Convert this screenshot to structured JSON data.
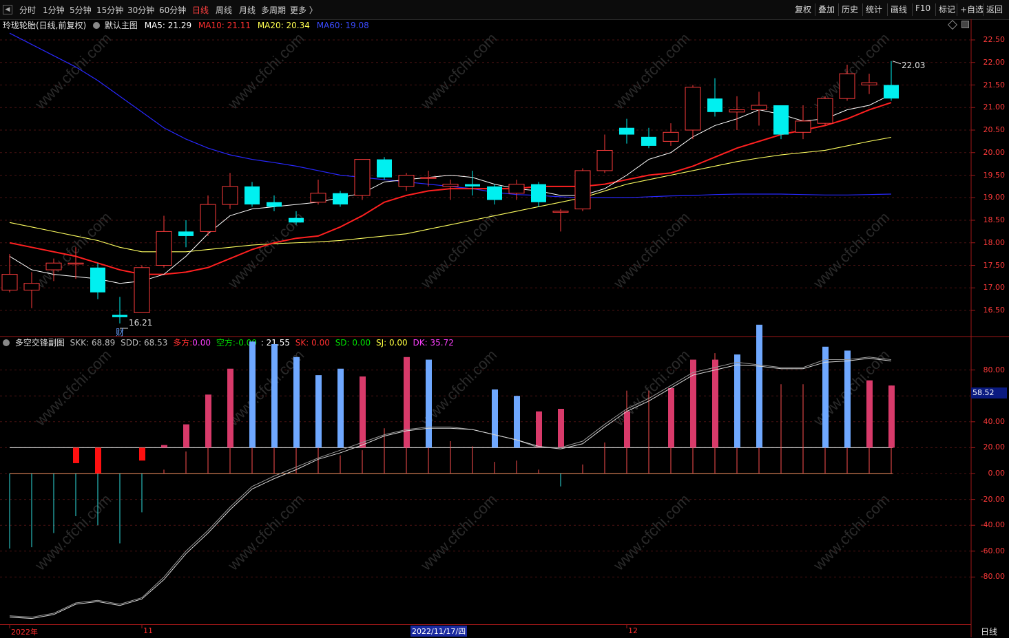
{
  "toolbar": {
    "left_items": [
      "分时",
      "1分钟",
      "5分钟",
      "15分钟",
      "30分钟",
      "60分钟",
      "日线",
      "周线",
      "月线",
      "多周期",
      "更多 〉"
    ],
    "active_item": "日线",
    "right_items": [
      "复权",
      "叠加",
      "历史",
      "统计",
      "画线",
      "F10",
      "标记",
      "+自选",
      "返回"
    ]
  },
  "main_header": {
    "stock_name": "玲珑轮胎(日线,前复权)",
    "template": "默认主图",
    "ma5": "MA5: 21.29",
    "ma10": "MA10: 21.11",
    "ma20": "MA20: 20.34",
    "ma60": "MA60: 19.08"
  },
  "sub_header": {
    "title": "多空交锋副图",
    "skk": "SKK: 68.89",
    "sdd": "SDD: 68.53",
    "duofang_label": "多方:",
    "duofang_value": "0.00",
    "kongfang_label": "空方:",
    "kongfang_value": "-0.00",
    "extra": ": 21.55",
    "sk": "SK: 0.00",
    "sd": "SD: 0.00",
    "sj": "SJ: 0.00",
    "dk": "DK: 35.72"
  },
  "price_axis": [
    "22.50",
    "22.00",
    "21.50",
    "21.00",
    "20.50",
    "20.00",
    "19.50",
    "19.00",
    "18.50",
    "18.00",
    "17.50",
    "17.00",
    "16.50"
  ],
  "sub_axis": [
    "80.00",
    "60.00",
    "40.00",
    "20.00",
    "0.00",
    "-20.00",
    "-40.00",
    "-60.00",
    "-80.00"
  ],
  "sub_marker": "58.52",
  "annotations": {
    "high": "22.03",
    "low": "16.21",
    "cai": "财"
  },
  "date_axis": {
    "start": "2022年",
    "m11": "11",
    "cursor": "2022/11/17/四",
    "m12": "12",
    "period": "日线"
  },
  "watermark": "www.cfchi.com",
  "colors": {
    "up": "#ff3c3c",
    "down": "#00f0f0",
    "ma5": "#ffffff",
    "ma10": "#ff2020",
    "ma20": "#ffff60",
    "ma60": "#2828ff"
  },
  "chart_data": {
    "type": "candlestick",
    "candles": [
      {
        "o": 16.95,
        "c": 17.3,
        "h": 17.75,
        "l": 16.9
      },
      {
        "o": 16.95,
        "c": 17.1,
        "h": 17.35,
        "l": 16.55
      },
      {
        "o": 17.4,
        "c": 17.55,
        "h": 17.65,
        "l": 17.15
      },
      {
        "o": 17.55,
        "c": 17.55,
        "h": 17.9,
        "l": 17.2
      },
      {
        "o": 17.45,
        "c": 16.9,
        "h": 17.55,
        "l": 16.75
      },
      {
        "o": 16.4,
        "c": 16.35,
        "h": 16.8,
        "l": 16.21
      },
      {
        "o": 16.45,
        "c": 17.45,
        "h": 17.5,
        "l": 16.45
      },
      {
        "o": 17.5,
        "c": 18.25,
        "h": 18.6,
        "l": 17.45
      },
      {
        "o": 18.25,
        "c": 18.15,
        "h": 18.5,
        "l": 17.9
      },
      {
        "o": 18.25,
        "c": 18.85,
        "h": 19.05,
        "l": 18.15
      },
      {
        "o": 18.85,
        "c": 19.25,
        "h": 19.55,
        "l": 18.75
      },
      {
        "o": 19.25,
        "c": 18.85,
        "h": 19.35,
        "l": 18.8
      },
      {
        "o": 18.9,
        "c": 18.8,
        "h": 19.05,
        "l": 18.7
      },
      {
        "o": 18.55,
        "c": 18.45,
        "h": 18.7,
        "l": 18.4
      },
      {
        "o": 18.9,
        "c": 19.1,
        "h": 19.4,
        "l": 18.85
      },
      {
        "o": 19.1,
        "c": 18.85,
        "h": 19.15,
        "l": 18.8
      },
      {
        "o": 19.05,
        "c": 19.85,
        "h": 19.85,
        "l": 18.95
      },
      {
        "o": 19.85,
        "c": 19.45,
        "h": 19.9,
        "l": 19.4
      },
      {
        "o": 19.25,
        "c": 19.5,
        "h": 19.55,
        "l": 19.15
      },
      {
        "o": 19.45,
        "c": 19.45,
        "h": 19.6,
        "l": 19.25
      },
      {
        "o": 19.25,
        "c": 19.3,
        "h": 19.4,
        "l": 18.95
      },
      {
        "o": 19.3,
        "c": 19.25,
        "h": 19.6,
        "l": 19.05
      },
      {
        "o": 19.25,
        "c": 18.95,
        "h": 19.3,
        "l": 18.85
      },
      {
        "o": 19.1,
        "c": 19.3,
        "h": 19.4,
        "l": 18.95
      },
      {
        "o": 19.3,
        "c": 18.9,
        "h": 19.35,
        "l": 18.8
      },
      {
        "o": 18.7,
        "c": 18.7,
        "h": 18.75,
        "l": 18.25
      },
      {
        "o": 18.75,
        "c": 19.6,
        "h": 19.65,
        "l": 18.7
      },
      {
        "o": 19.6,
        "c": 20.05,
        "h": 20.4,
        "l": 19.55
      },
      {
        "o": 20.55,
        "c": 20.4,
        "h": 20.75,
        "l": 20.2
      },
      {
        "o": 20.35,
        "c": 20.15,
        "h": 20.55,
        "l": 20.1
      },
      {
        "o": 20.25,
        "c": 20.45,
        "h": 20.65,
        "l": 20.15
      },
      {
        "o": 20.5,
        "c": 21.45,
        "h": 21.5,
        "l": 20.3
      },
      {
        "o": 21.2,
        "c": 20.9,
        "h": 21.65,
        "l": 20.8
      },
      {
        "o": 20.9,
        "c": 20.95,
        "h": 21.25,
        "l": 20.5
      },
      {
        "o": 20.95,
        "c": 21.05,
        "h": 21.35,
        "l": 20.6
      },
      {
        "o": 21.05,
        "c": 20.4,
        "h": 21.05,
        "l": 20.3
      },
      {
        "o": 20.45,
        "c": 20.7,
        "h": 21.05,
        "l": 20.3
      },
      {
        "o": 20.65,
        "c": 21.2,
        "h": 21.25,
        "l": 20.6
      },
      {
        "o": 21.2,
        "c": 21.75,
        "h": 21.95,
        "l": 21.15
      },
      {
        "o": 21.5,
        "c": 21.55,
        "h": 21.75,
        "l": 21.3
      },
      {
        "o": 21.5,
        "c": 21.2,
        "h": 22.03,
        "l": 21.15
      }
    ],
    "ma5": [
      17.7,
      17.4,
      17.3,
      17.25,
      17.2,
      17.1,
      17.15,
      17.3,
      17.7,
      18.2,
      18.6,
      18.75,
      18.8,
      18.85,
      18.9,
      19.0,
      19.1,
      19.35,
      19.4,
      19.45,
      19.5,
      19.45,
      19.3,
      19.2,
      19.15,
      19.05,
      19.05,
      19.2,
      19.5,
      19.85,
      20.0,
      20.35,
      20.6,
      20.75,
      20.95,
      20.85,
      20.7,
      20.75,
      20.95,
      21.05,
      21.29
    ],
    "ma10": [
      18.0,
      17.9,
      17.8,
      17.7,
      17.55,
      17.4,
      17.3,
      17.3,
      17.35,
      17.45,
      17.65,
      17.85,
      18.0,
      18.1,
      18.15,
      18.35,
      18.6,
      18.9,
      19.05,
      19.15,
      19.2,
      19.2,
      19.2,
      19.2,
      19.25,
      19.25,
      19.25,
      19.3,
      19.4,
      19.5,
      19.55,
      19.7,
      19.9,
      20.1,
      20.25,
      20.4,
      20.5,
      20.6,
      20.75,
      20.95,
      21.11
    ],
    "ma20": [
      18.45,
      18.35,
      18.25,
      18.15,
      18.05,
      17.9,
      17.8,
      17.8,
      17.8,
      17.85,
      17.9,
      17.95,
      17.98,
      18.0,
      18.02,
      18.05,
      18.1,
      18.15,
      18.2,
      18.3,
      18.4,
      18.5,
      18.6,
      18.7,
      18.8,
      18.9,
      19.0,
      19.15,
      19.3,
      19.4,
      19.5,
      19.6,
      19.7,
      19.8,
      19.88,
      19.95,
      20.0,
      20.05,
      20.15,
      20.25,
      20.34
    ],
    "ma60": [
      22.65,
      22.4,
      22.15,
      21.9,
      21.6,
      21.25,
      20.9,
      20.55,
      20.3,
      20.1,
      19.95,
      19.85,
      19.78,
      19.7,
      19.6,
      19.5,
      19.45,
      19.4,
      19.35,
      19.3,
      19.25,
      19.2,
      19.12,
      19.07,
      19.05,
      19.02,
      19.0,
      19.0,
      19.0,
      19.02,
      19.04,
      19.05,
      19.07,
      19.08,
      19.08,
      19.08,
      19.07,
      19.06,
      19.06,
      19.07,
      19.08
    ],
    "sub_bars": [
      -58,
      -57,
      -46,
      -33,
      -40,
      -54,
      -30,
      3,
      17,
      26,
      37,
      34,
      25,
      20,
      30,
      14,
      18,
      35,
      49,
      45,
      25,
      21,
      9,
      10,
      3,
      -10,
      7,
      24,
      64,
      64,
      66,
      70,
      93,
      65,
      70,
      69,
      69,
      58,
      63,
      69,
      68
    ],
    "sub_big_bars": [
      0,
      0,
      0,
      -12,
      -20,
      0,
      -10,
      2,
      18,
      41,
      61,
      82,
      80,
      70,
      56,
      61,
      55,
      0,
      70,
      68,
      0,
      0,
      45,
      40,
      28,
      30,
      0,
      0,
      28,
      0,
      46,
      68,
      68,
      72,
      95,
      0,
      0,
      78,
      75,
      52,
      48
    ],
    "skk": [
      -110,
      -111,
      -108,
      -100,
      -98,
      -101,
      -96,
      -80,
      -60,
      -44,
      -26,
      -10,
      -2,
      5,
      12,
      18,
      24,
      30,
      34,
      36,
      36,
      34,
      30,
      26,
      20,
      20,
      25,
      38,
      50,
      58,
      68,
      78,
      82,
      86,
      84,
      82,
      82,
      88,
      88,
      90,
      88
    ],
    "sdd": [
      -111,
      -112,
      -109,
      -101,
      -99,
      -102,
      -97,
      -82,
      -62,
      -46,
      -28,
      -12,
      -4,
      3,
      11,
      16,
      22,
      29,
      33,
      35,
      35,
      34,
      30,
      26,
      21,
      19,
      23,
      36,
      48,
      56,
      66,
      76,
      80,
      84,
      83,
      81,
      81,
      86,
      87,
      89,
      87
    ]
  }
}
